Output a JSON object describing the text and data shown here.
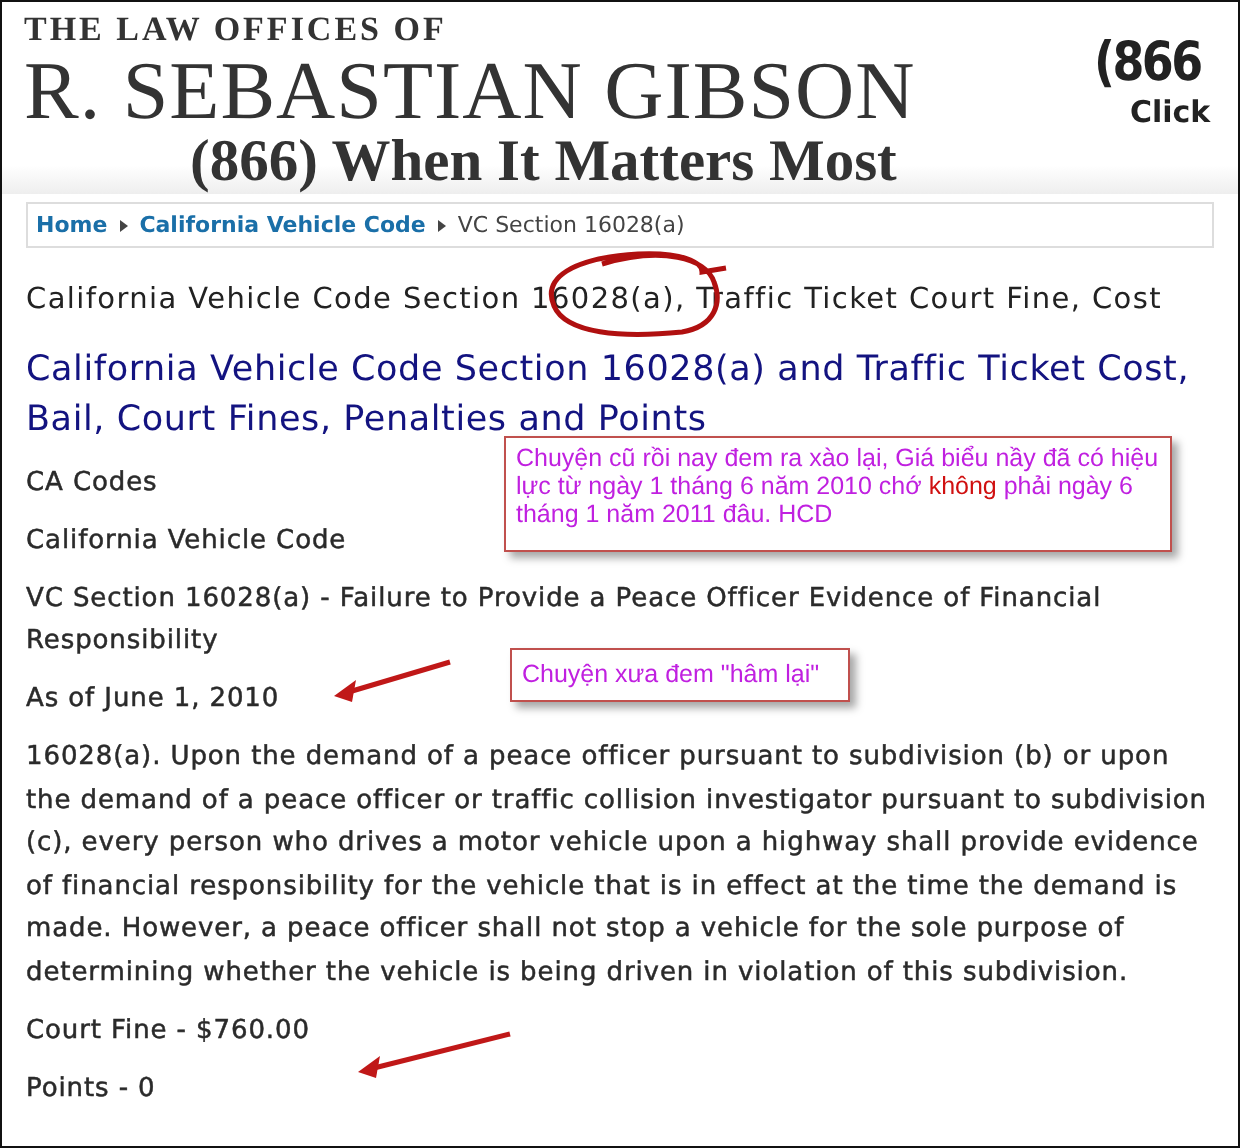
{
  "header": {
    "overline": "THE LAW OFFICES OF",
    "name": "R. SEBASTIAN GIBSON",
    "tagline": "(866) When It Matters Most",
    "phone": "(866",
    "link": "Click"
  },
  "breadcrumb": [
    {
      "kind": "link",
      "label": "Home"
    },
    {
      "kind": "link",
      "label": "California Vehicle Code"
    },
    {
      "kind": "current",
      "label": "VC Section 16028(a)"
    }
  ],
  "page_title": "California Vehicle Code Section 16028(a), Traffic Ticket Court Fine, Cost",
  "heading": "California Vehicle Code Section 16028(a) and Traffic Ticket Cost, Bail, Court Fines, Penalties and Points",
  "paragraphs": [
    "CA Codes",
    "California Vehicle Code",
    "VC Section 16028(a) - Failure to Provide a Peace Officer Evidence of Financial Responsibility",
    "As of June 1, 2010",
    "16028(a). Upon the demand of a peace officer pursuant to subdivision (b) or upon the demand of a peace officer or traffic collision investigator pursuant to subdivision (c), every person who drives a motor vehicle upon a highway shall provide evidence of financial responsibility for the vehicle that is in effect at the time the demand is made. However, a peace officer shall not stop a vehicle for the sole purpose of determining whether the vehicle is being driven in violation of this subdivision.",
    "Court Fine - $760.00",
    "Points - 0"
  ],
  "annotations": [
    {
      "kind": "callout",
      "segments": [
        {
          "text": "Chuyện cũ rồi nay đem ra xào lại, Giá biểu nầy đã có hiệu lực từ ngày 1 tháng 6 năm 2010 chớ ",
          "highlight": false
        },
        {
          "text": "không",
          "highlight": true
        },
        {
          "text": " phải ngày 6 tháng 1 năm 2011 đâu. HCD",
          "highlight": false
        }
      ]
    },
    {
      "kind": "callout",
      "segments": [
        {
          "text": "Chuyện xưa đem \"hâm lại\"",
          "highlight": false
        }
      ]
    },
    {
      "kind": "circle"
    },
    {
      "kind": "arrow"
    },
    {
      "kind": "arrow"
    }
  ]
}
